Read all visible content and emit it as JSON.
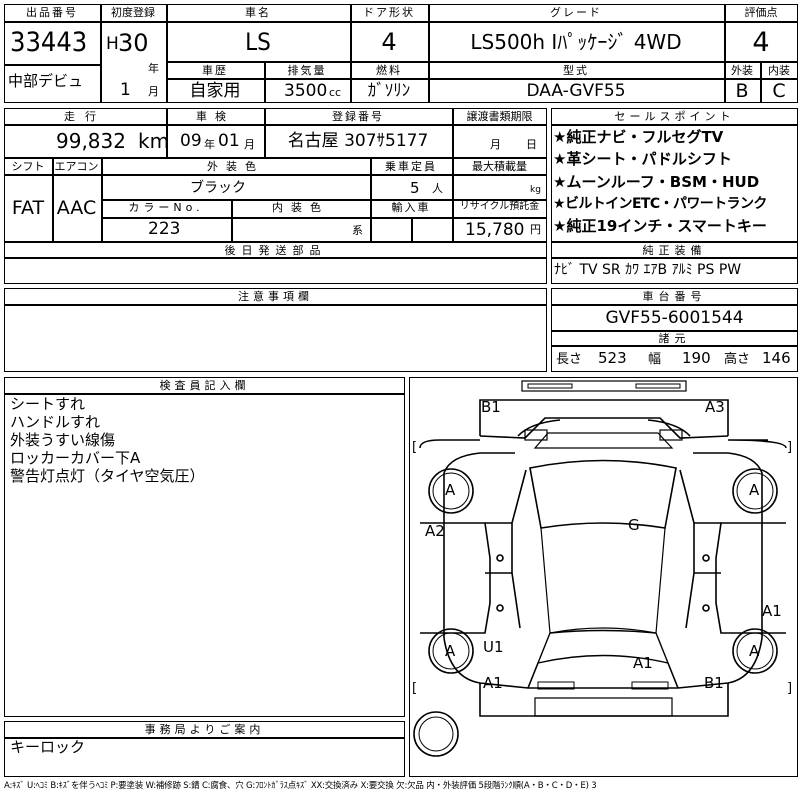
{
  "header": {
    "lot_label": "出品番号",
    "lot_no": "33443",
    "first_reg_label": "初度登録",
    "era": "H",
    "year": "30",
    "year_unit": "年",
    "month": "1",
    "month_unit": "月",
    "name_label": "車名",
    "name": "LS",
    "door_label": "ドア形状",
    "door": "4",
    "grade_label": "グレード",
    "grade": "LS500h Iﾊﾟｯｹｰｼﾞ 4WD",
    "score_label": "評価点",
    "score": "4",
    "debut": "中部デビュ",
    "history_label": "車歴",
    "history": "自家用",
    "displacement_label": "排気量",
    "displacement": "3500",
    "displacement_unit": "cc",
    "fuel_label": "燃料",
    "fuel": "ｶﾞｿﾘﾝ",
    "model_label": "型式",
    "model": "DAA-GVF55",
    "exterior_label": "外装",
    "exterior": "B",
    "interior_label": "内装",
    "interior": "C"
  },
  "row2": {
    "mileage_label": "走行",
    "mileage": "99,832",
    "mileage_unit": "km",
    "inspection_label": "車検",
    "insp_year": "09",
    "insp_year_unit": "年",
    "insp_month": "01",
    "insp_month_unit": "月",
    "plate_label": "登録番号",
    "plate": "名古屋 307ｻ5177",
    "transfer_label": "譲渡書類期限",
    "transfer_month": "月",
    "transfer_day": "日",
    "shift_label": "シフト",
    "shift": "FAT",
    "ac_label": "エアコン",
    "ac": "AAC",
    "color_label": "外装色",
    "color": "ブラック",
    "capacity_label": "乗車定員",
    "capacity": "5",
    "capacity_unit": "人",
    "load_label": "最大積載量",
    "load_unit": "kg",
    "color_no_label": "カラーNo.",
    "color_no": "223",
    "int_color_label": "内装色",
    "int_color_unit": "系",
    "import_label": "輸入車",
    "recycle_label": "リサイクル預託金",
    "recycle": "15,780",
    "recycle_unit": "円",
    "later_label": "後日発送部品"
  },
  "sales_points": {
    "title": "セールスポイント",
    "items": [
      "★純正ナビ・フルセグTV",
      "★革シート・パドルシフト",
      "★ムーンルーフ・BSM・HUD",
      "★ビルトインETC・パワートランク",
      "★純正19インチ・スマートキー"
    ]
  },
  "equipment": {
    "title": "純正装備",
    "items": "ﾅﾋﾞ TV SR ｶﾜ ｴｱB ｱﾙﾐ PS PW"
  },
  "notes": {
    "title": "注意事項欄"
  },
  "chassis": {
    "title": "車台番号",
    "number": "GVF55-6001544",
    "dims_title": "諸元",
    "length_label": "長さ",
    "length": "523",
    "width_label": "幅",
    "width": "190",
    "height_label": "高さ",
    "height": "146"
  },
  "inspector": {
    "title": "検査員記入欄",
    "lines": [
      "シートすれ",
      "ハンドルすれ",
      "外装うすい線傷",
      "ロッカーカバー下A",
      "警告灯点灯（タイヤ空気圧）"
    ]
  },
  "office": {
    "title": "事務局よりご案内",
    "text": "キーロック"
  },
  "diagram": {
    "marks": {
      "front_left": "B1",
      "front_right": "A3",
      "wheel_fl": "A",
      "wheel_fr": "A",
      "wheel_rl": "A",
      "wheel_rr": "A",
      "left_door": "A2",
      "right_rear": "A1",
      "glass": "G",
      "rear_left_u": "U1",
      "rear_center": "A1",
      "rear_left": "A1",
      "rear_right": "B1"
    }
  },
  "legend": "A:ｷｽﾞ U:ﾍｺﾐ B:ｷｽﾞを伴うﾍｺﾐ P:要塗装 W:補修跡 S:錆 C:腐食、穴 G:ﾌﾛﾝﾄｶﾞﾗｽ点ｷｽﾞ XX:交換済み X:要交換 欠:欠品 内・外装評価 5段階ﾗﾝｸ順(A・B・C・D・E) 3"
}
